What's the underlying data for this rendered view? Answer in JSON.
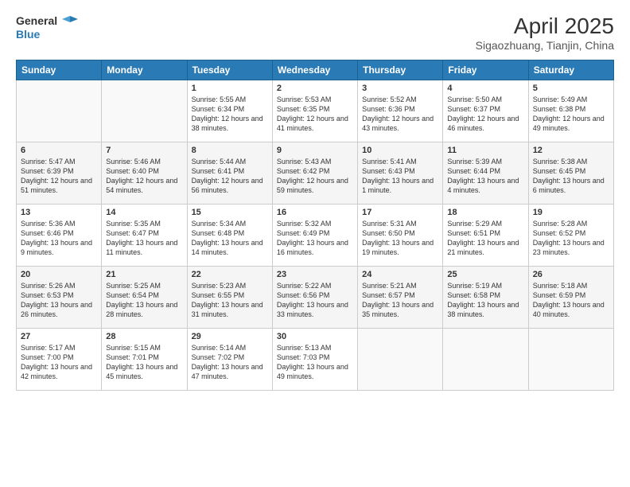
{
  "header": {
    "logo_line1": "General",
    "logo_line2": "Blue",
    "month": "April 2025",
    "location": "Sigaozhuang, Tianjin, China"
  },
  "days_of_week": [
    "Sunday",
    "Monday",
    "Tuesday",
    "Wednesday",
    "Thursday",
    "Friday",
    "Saturday"
  ],
  "weeks": [
    [
      {
        "day": "",
        "info": ""
      },
      {
        "day": "",
        "info": ""
      },
      {
        "day": "1",
        "info": "Sunrise: 5:55 AM\nSunset: 6:34 PM\nDaylight: 12 hours and 38 minutes."
      },
      {
        "day": "2",
        "info": "Sunrise: 5:53 AM\nSunset: 6:35 PM\nDaylight: 12 hours and 41 minutes."
      },
      {
        "day": "3",
        "info": "Sunrise: 5:52 AM\nSunset: 6:36 PM\nDaylight: 12 hours and 43 minutes."
      },
      {
        "day": "4",
        "info": "Sunrise: 5:50 AM\nSunset: 6:37 PM\nDaylight: 12 hours and 46 minutes."
      },
      {
        "day": "5",
        "info": "Sunrise: 5:49 AM\nSunset: 6:38 PM\nDaylight: 12 hours and 49 minutes."
      }
    ],
    [
      {
        "day": "6",
        "info": "Sunrise: 5:47 AM\nSunset: 6:39 PM\nDaylight: 12 hours and 51 minutes."
      },
      {
        "day": "7",
        "info": "Sunrise: 5:46 AM\nSunset: 6:40 PM\nDaylight: 12 hours and 54 minutes."
      },
      {
        "day": "8",
        "info": "Sunrise: 5:44 AM\nSunset: 6:41 PM\nDaylight: 12 hours and 56 minutes."
      },
      {
        "day": "9",
        "info": "Sunrise: 5:43 AM\nSunset: 6:42 PM\nDaylight: 12 hours and 59 minutes."
      },
      {
        "day": "10",
        "info": "Sunrise: 5:41 AM\nSunset: 6:43 PM\nDaylight: 13 hours and 1 minute."
      },
      {
        "day": "11",
        "info": "Sunrise: 5:39 AM\nSunset: 6:44 PM\nDaylight: 13 hours and 4 minutes."
      },
      {
        "day": "12",
        "info": "Sunrise: 5:38 AM\nSunset: 6:45 PM\nDaylight: 13 hours and 6 minutes."
      }
    ],
    [
      {
        "day": "13",
        "info": "Sunrise: 5:36 AM\nSunset: 6:46 PM\nDaylight: 13 hours and 9 minutes."
      },
      {
        "day": "14",
        "info": "Sunrise: 5:35 AM\nSunset: 6:47 PM\nDaylight: 13 hours and 11 minutes."
      },
      {
        "day": "15",
        "info": "Sunrise: 5:34 AM\nSunset: 6:48 PM\nDaylight: 13 hours and 14 minutes."
      },
      {
        "day": "16",
        "info": "Sunrise: 5:32 AM\nSunset: 6:49 PM\nDaylight: 13 hours and 16 minutes."
      },
      {
        "day": "17",
        "info": "Sunrise: 5:31 AM\nSunset: 6:50 PM\nDaylight: 13 hours and 19 minutes."
      },
      {
        "day": "18",
        "info": "Sunrise: 5:29 AM\nSunset: 6:51 PM\nDaylight: 13 hours and 21 minutes."
      },
      {
        "day": "19",
        "info": "Sunrise: 5:28 AM\nSunset: 6:52 PM\nDaylight: 13 hours and 23 minutes."
      }
    ],
    [
      {
        "day": "20",
        "info": "Sunrise: 5:26 AM\nSunset: 6:53 PM\nDaylight: 13 hours and 26 minutes."
      },
      {
        "day": "21",
        "info": "Sunrise: 5:25 AM\nSunset: 6:54 PM\nDaylight: 13 hours and 28 minutes."
      },
      {
        "day": "22",
        "info": "Sunrise: 5:23 AM\nSunset: 6:55 PM\nDaylight: 13 hours and 31 minutes."
      },
      {
        "day": "23",
        "info": "Sunrise: 5:22 AM\nSunset: 6:56 PM\nDaylight: 13 hours and 33 minutes."
      },
      {
        "day": "24",
        "info": "Sunrise: 5:21 AM\nSunset: 6:57 PM\nDaylight: 13 hours and 35 minutes."
      },
      {
        "day": "25",
        "info": "Sunrise: 5:19 AM\nSunset: 6:58 PM\nDaylight: 13 hours and 38 minutes."
      },
      {
        "day": "26",
        "info": "Sunrise: 5:18 AM\nSunset: 6:59 PM\nDaylight: 13 hours and 40 minutes."
      }
    ],
    [
      {
        "day": "27",
        "info": "Sunrise: 5:17 AM\nSunset: 7:00 PM\nDaylight: 13 hours and 42 minutes."
      },
      {
        "day": "28",
        "info": "Sunrise: 5:15 AM\nSunset: 7:01 PM\nDaylight: 13 hours and 45 minutes."
      },
      {
        "day": "29",
        "info": "Sunrise: 5:14 AM\nSunset: 7:02 PM\nDaylight: 13 hours and 47 minutes."
      },
      {
        "day": "30",
        "info": "Sunrise: 5:13 AM\nSunset: 7:03 PM\nDaylight: 13 hours and 49 minutes."
      },
      {
        "day": "",
        "info": ""
      },
      {
        "day": "",
        "info": ""
      },
      {
        "day": "",
        "info": ""
      }
    ]
  ]
}
